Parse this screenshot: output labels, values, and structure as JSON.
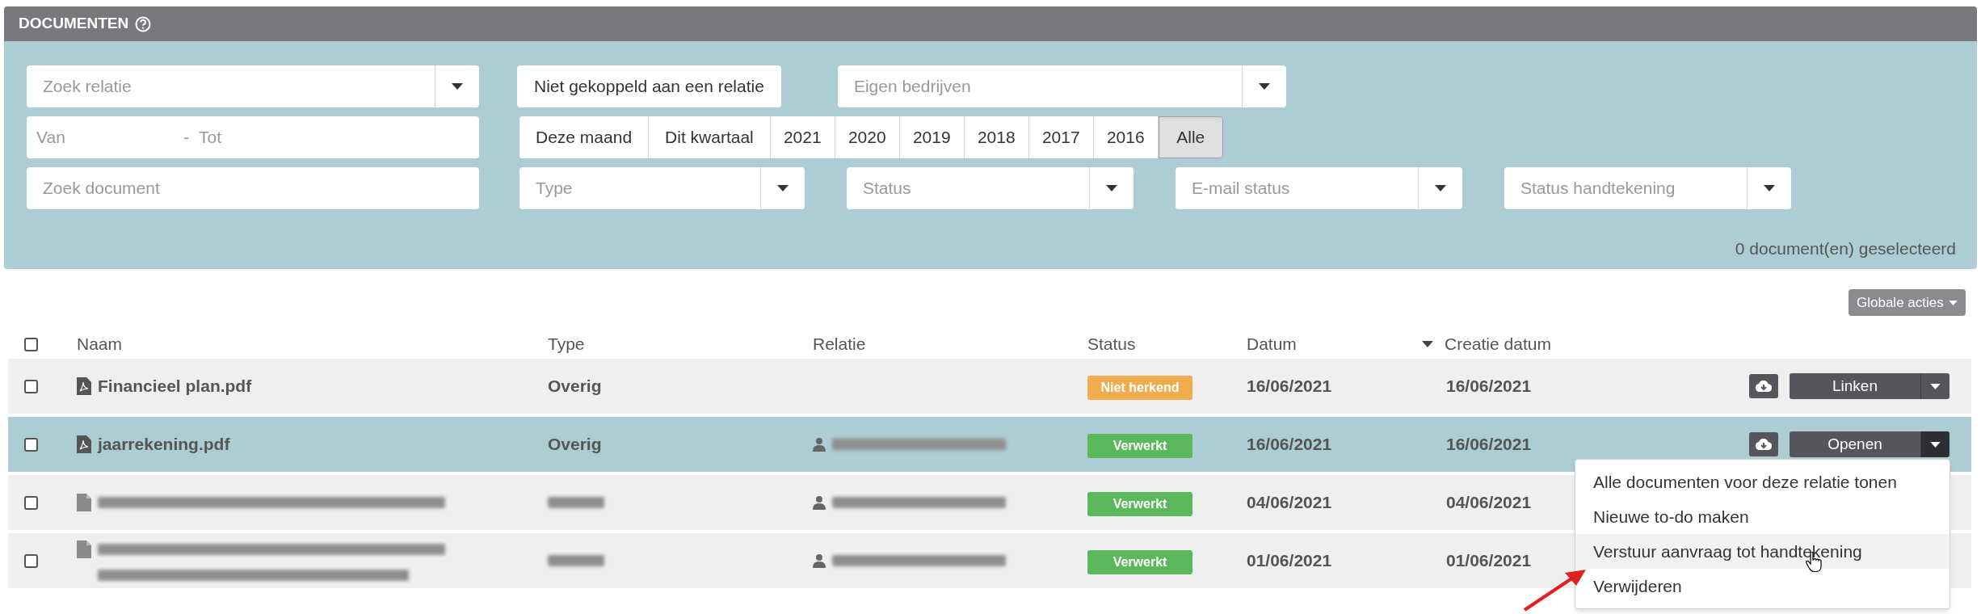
{
  "panel": {
    "title": "DOCUMENTEN"
  },
  "filters": {
    "relation": {
      "placeholder": "Zoek relatie"
    },
    "unlinked_button": "Niet gekoppeld aan een relatie",
    "own_companies": {
      "placeholder": "Eigen bedrijven"
    },
    "date_from": {
      "placeholder": "Van"
    },
    "date_to": {
      "placeholder": "Tot"
    },
    "date_separator": "-",
    "periods": [
      {
        "label": "Deze maand",
        "selected": false
      },
      {
        "label": "Dit kwartaal",
        "selected": false
      },
      {
        "label": "2021",
        "selected": false
      },
      {
        "label": "2020",
        "selected": false
      },
      {
        "label": "2019",
        "selected": false
      },
      {
        "label": "2018",
        "selected": false
      },
      {
        "label": "2017",
        "selected": false
      },
      {
        "label": "2016",
        "selected": false
      },
      {
        "label": "Alle",
        "selected": true
      }
    ],
    "document": {
      "placeholder": "Zoek document"
    },
    "selects": [
      {
        "placeholder": "Type"
      },
      {
        "placeholder": "Status"
      },
      {
        "placeholder": "E-mail status"
      },
      {
        "placeholder": "Status handtekening"
      }
    ],
    "selected_count": "0 document(en) geselecteerd"
  },
  "global_actions": "Globale acties",
  "table": {
    "columns": [
      {
        "label": "Naam",
        "sorted": false
      },
      {
        "label": "Type",
        "sorted": false
      },
      {
        "label": "Relatie",
        "sorted": false
      },
      {
        "label": "Status",
        "sorted": false
      },
      {
        "label": "Datum",
        "sorted": false
      },
      {
        "label": "Creatie datum",
        "sorted": true
      }
    ],
    "select_all": {
      "checked": false
    },
    "rows": [
      {
        "checked": false,
        "selected": false,
        "name": "Financieel plan.pdf",
        "type": "Overig",
        "status": {
          "label": "Niet herkend",
          "color": "#f0ad4e"
        },
        "date": "16/06/2021",
        "created": "16/06/2021",
        "action": "Linken"
      },
      {
        "checked": false,
        "selected": true,
        "name": "jaarrekening.pdf",
        "type": "Overig",
        "relation_redacted": true,
        "status": {
          "label": "Verwerkt",
          "color": "#5cb85c"
        },
        "date": "16/06/2021",
        "created": "16/06/2021",
        "action": "Openen",
        "menu": [
          {
            "label": "Alle documenten voor deze relatie tonen",
            "hovered": false
          },
          {
            "label": "Nieuwe to-do maken",
            "hovered": false
          },
          {
            "label": "Verstuur aanvraag tot handtekening",
            "hovered": true
          },
          {
            "label": "Verwijderen",
            "hovered": false
          }
        ]
      },
      {
        "checked": false,
        "selected": false,
        "name_redacted": true,
        "type_redacted": true,
        "relation_redacted": true,
        "status": {
          "label": "Verwerkt",
          "color": "#5cb85c"
        },
        "date": "04/06/2021",
        "created": "04/06/2021"
      },
      {
        "checked": false,
        "selected": false,
        "name_redacted": true,
        "name_wraps": true,
        "type_redacted": true,
        "relation_redacted": true,
        "status": {
          "label": "Verwerkt",
          "color": "#5cb85c"
        },
        "date": "01/06/2021",
        "created": "01/06/2021"
      }
    ]
  }
}
